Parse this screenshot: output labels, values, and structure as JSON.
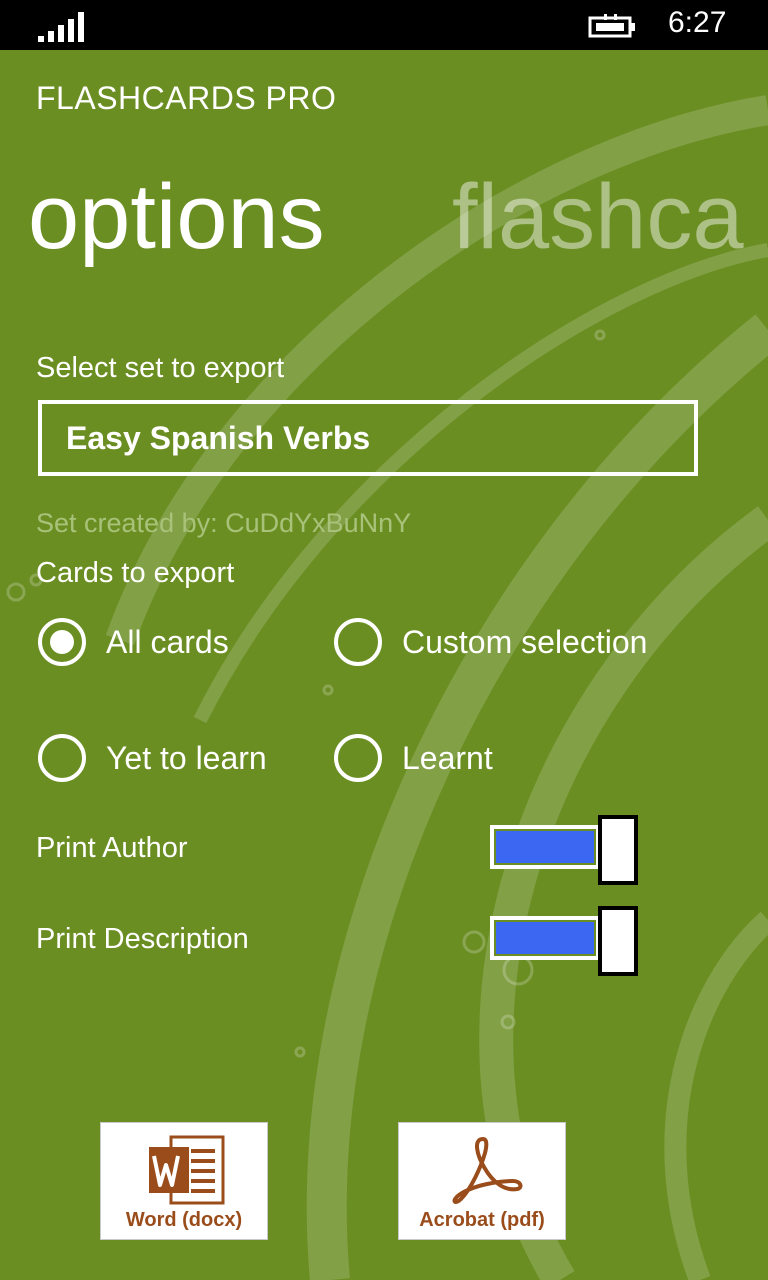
{
  "status_bar": {
    "time": "6:27",
    "signal_icon": "signal-bars-icon",
    "battery_icon": "battery-charging-icon"
  },
  "app": {
    "title": "FLASHCARDS PRO"
  },
  "pivot": {
    "current": "options",
    "next": "flashca"
  },
  "export": {
    "select_label": "Select set to export",
    "selected_set": "Easy Spanish Verbs",
    "created_by": "Set created by: CuDdYxBuNnY",
    "cards_label": "Cards to export",
    "options": [
      {
        "label": "All cards",
        "selected": true
      },
      {
        "label": "Custom selection",
        "selected": false
      },
      {
        "label": "Yet to learn",
        "selected": false
      },
      {
        "label": "Learnt",
        "selected": false
      }
    ]
  },
  "toggles": [
    {
      "label": "Print Author",
      "on": true
    },
    {
      "label": "Print Description",
      "on": true
    }
  ],
  "buttons": {
    "word": {
      "label": "Word (docx)",
      "icon": "word-document-icon"
    },
    "acrobat": {
      "label": "Acrobat (pdf)",
      "icon": "acrobat-pdf-icon"
    }
  },
  "colors": {
    "background": "#6b8e23",
    "toggle_fill": "#3b67f2",
    "brand_word": "#9a4d1b"
  }
}
